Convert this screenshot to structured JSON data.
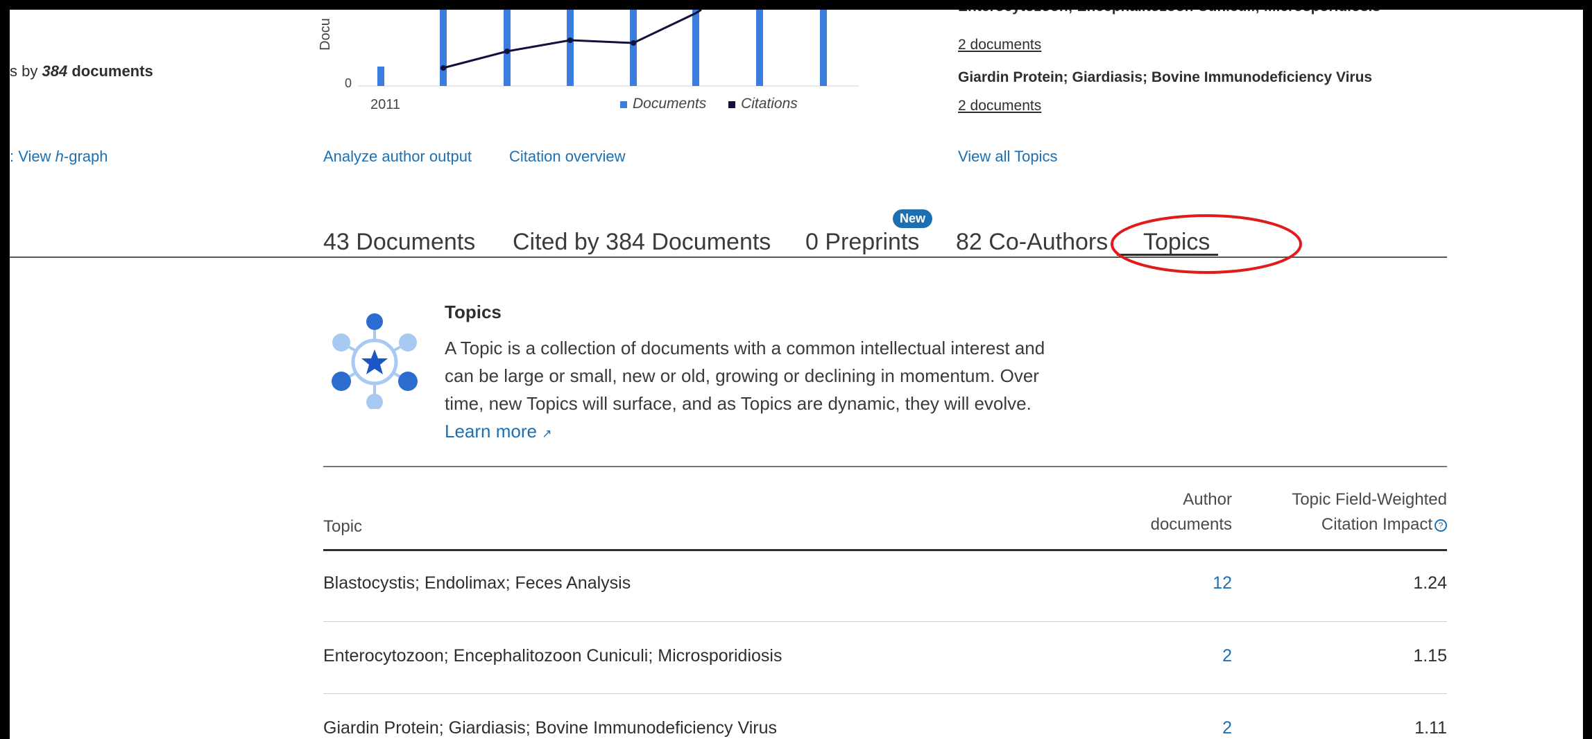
{
  "left_panel": {
    "cited_partial": "s by",
    "cited_count": "384",
    "cited_suffix": "documents",
    "hgraph_prefix": ":",
    "hgraph_view": "View",
    "hgraph_h": "h",
    "hgraph_rest": "-graph"
  },
  "chart": {
    "ylabel_partial": "Docu",
    "y_zero": "0",
    "x_label": "2011",
    "legend_documents": "Documents",
    "legend_citations": "Citations",
    "colors": {
      "documents": "#3b7ddd",
      "citations": "#10123d"
    }
  },
  "chart_data": {
    "type": "bar",
    "note_visible_only": true,
    "series": [
      {
        "name": "Documents",
        "type": "bar"
      },
      {
        "name": "Citations",
        "type": "line"
      }
    ],
    "x": [
      "2011"
    ]
  },
  "links": {
    "analyze": "Analyze author output",
    "citation_overview": "Citation overview",
    "view_all_topics": "View all Topics"
  },
  "top_topics": {
    "partial_title": "Enterocytozoon; Encephalitozoon Cuniculi; Microsporidiosis",
    "item1_docs": "2 documents",
    "item2_title": "Giardin Protein; Giardiasis; Bovine Immunodeficiency Virus",
    "item2_docs": "2 documents"
  },
  "tabs": {
    "documents": "43 Documents",
    "cited_by": "Cited by 384 Documents",
    "preprints": "0 Preprints",
    "new_badge": "New",
    "coauthors": "82 Co-Authors",
    "topics": "Topics"
  },
  "info": {
    "heading": "Topics",
    "line1": "A Topic is a collection of documents with a common intellectual interest and",
    "line2": "can be large or small, new or old, growing or declining in momentum. Over",
    "line3": "time, new Topics will surface, and as Topics are dynamic, they will evolve.",
    "learn_more": "Learn more"
  },
  "table": {
    "col_topic": "Topic",
    "col_author_1": "Author",
    "col_author_2": "documents",
    "col_fwci_1": "Topic Field-Weighted",
    "col_fwci_2": "Citation Impact",
    "rows": [
      {
        "topic": "Blastocystis; Endolimax; Feces Analysis",
        "docs": "12",
        "fwci": "1.24"
      },
      {
        "topic": "Enterocytozoon; Encephalitozoon Cuniculi; Microsporidiosis",
        "docs": "2",
        "fwci": "1.15"
      },
      {
        "topic": "Giardin Protein; Giardiasis; Bovine Immunodeficiency Virus",
        "docs": "2",
        "fwci": "1.11"
      }
    ]
  },
  "annotation": {
    "circle_color": "#e01b1b"
  }
}
